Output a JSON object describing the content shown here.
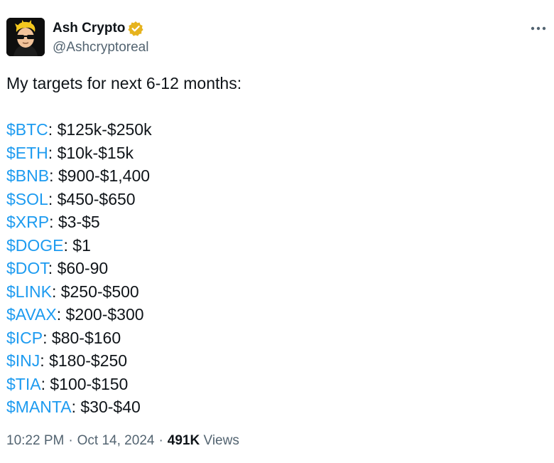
{
  "author": {
    "display_name": "Ash Crypto",
    "handle": "@Ashcryptoreal",
    "verified_icon": "gold-verified-badge-icon",
    "avatar_icon": "cartoon-avatar-sunglasses",
    "verified_color": "#e6b31e"
  },
  "more_icon": "ellipsis-icon",
  "post": {
    "intro": "My targets for next 6-12 months:",
    "targets": [
      {
        "ticker": "$BTC",
        "range": ": $125k-$250k"
      },
      {
        "ticker": "$ETH",
        "range": ": $10k-$15k"
      },
      {
        "ticker": "$BNB",
        "range": ": $900-$1,400"
      },
      {
        "ticker": "$SOL",
        "range": ": $450-$650"
      },
      {
        "ticker": "$XRP",
        "range": ": $3-$5"
      },
      {
        "ticker": "$DOGE",
        "range": ": $1"
      },
      {
        "ticker": "$DOT",
        "range": ": $60-90"
      },
      {
        "ticker": "$LINK",
        "range": ": $250-$500"
      },
      {
        "ticker": "$AVAX",
        "range": ": $200-$300"
      },
      {
        "ticker": "$ICP",
        "range": ": $80-$160"
      },
      {
        "ticker": "$INJ",
        "range": ": $180-$250"
      },
      {
        "ticker": "$TIA",
        "range": ": $100-$150"
      },
      {
        "ticker": "$MANTA",
        "range": ": $30-$40"
      }
    ]
  },
  "meta": {
    "time": "10:22 PM",
    "separator": "·",
    "date": "Oct 14, 2024",
    "views_count": "491K",
    "views_label": "Views"
  },
  "colors": {
    "link": "#1d9bf0",
    "text": "#0f1419",
    "secondary": "#536471"
  }
}
